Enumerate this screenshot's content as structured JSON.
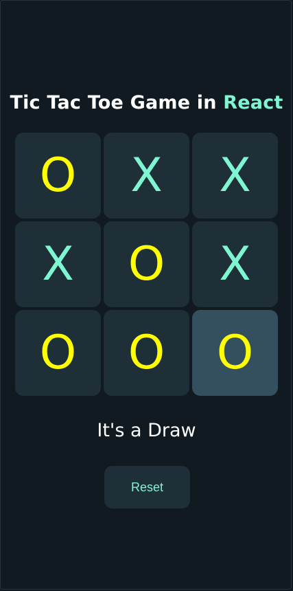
{
  "title": {
    "prefix": "Tic Tac Toe Game in ",
    "accent": "React"
  },
  "board": {
    "cells": [
      {
        "mark": "O",
        "highlighted": false
      },
      {
        "mark": "X",
        "highlighted": false
      },
      {
        "mark": "X",
        "highlighted": false
      },
      {
        "mark": "X",
        "highlighted": false
      },
      {
        "mark": "O",
        "highlighted": false
      },
      {
        "mark": "X",
        "highlighted": false
      },
      {
        "mark": "O",
        "highlighted": false
      },
      {
        "mark": "O",
        "highlighted": false
      },
      {
        "mark": "O",
        "highlighted": true
      }
    ]
  },
  "status": "It's a Draw",
  "reset_label": "Reset",
  "colors": {
    "background": "#111a21",
    "cell": "#1f2f38",
    "cell_highlight": "#34505f",
    "x_mark": "#7ff6d2",
    "o_mark": "#ffff00",
    "accent": "#7ff6d2",
    "text": "#ffffff"
  }
}
